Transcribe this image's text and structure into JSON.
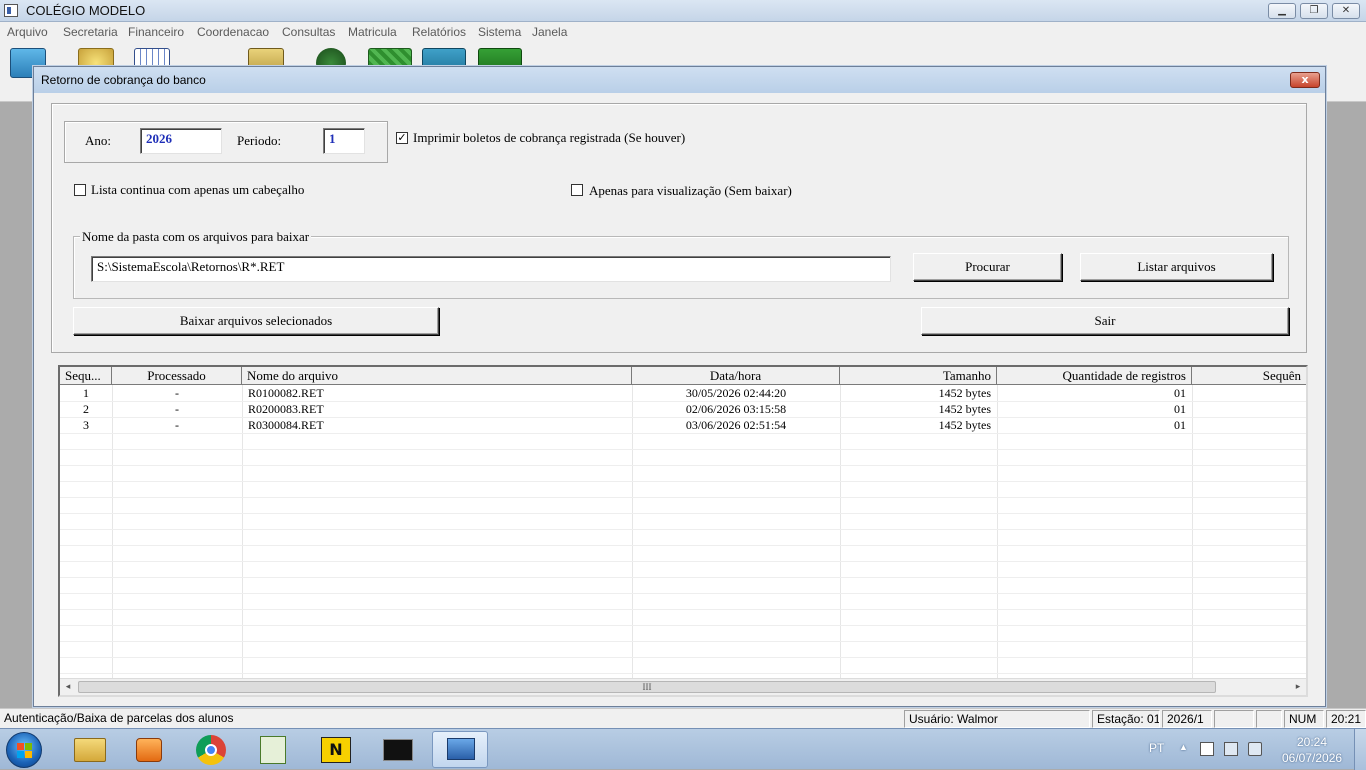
{
  "app": {
    "title": "COLÉGIO MODELO",
    "menu": [
      "Arquivo",
      "Secretaria",
      "Financeiro",
      "Coordenacao",
      "Consultas",
      "Matricula",
      "Relatórios",
      "Sistema",
      "Janela"
    ]
  },
  "dialog": {
    "title": "Retorno de cobrança do banco",
    "close_label": "x",
    "ano_label": "Ano:",
    "ano_value": "2026",
    "periodo_label": "Periodo:",
    "periodo_value": "1",
    "imprimir_label": "Imprimir boletos de cobrança registrada (Se houver)",
    "imprimir_checked": "✓",
    "lista_label": "Lista continua com apenas um cabeçalho",
    "visualizacao_label": "Apenas para visualização (Sem baixar)",
    "pasta_group": "Nome da pasta com os arquivos para baixar",
    "pasta_value": "S:\\SistemaEscola\\Retornos\\R*.RET",
    "procurar_label": "Procurar",
    "listar_label": "Listar arquivos",
    "baixar_label": "Baixar arquivos selecionados",
    "sair_label": "Sair"
  },
  "grid": {
    "columns": [
      "Sequ...",
      "Processado",
      "Nome do arquivo",
      "Data/hora",
      "Tamanho",
      "Quantidade de registros",
      "Sequên"
    ],
    "rows": [
      {
        "seq": "1",
        "proc": "-",
        "nome": "R0100082.RET",
        "data": "30/05/2026 02:44:20",
        "tam": "1452 bytes",
        "qtd": "01"
      },
      {
        "seq": "2",
        "proc": "-",
        "nome": "R0200083.RET",
        "data": "02/06/2026 03:15:58",
        "tam": "1452 bytes",
        "qtd": "01"
      },
      {
        "seq": "3",
        "proc": "-",
        "nome": "R0300084.RET",
        "data": "03/06/2026 02:51:54",
        "tam": "1452 bytes",
        "qtd": "01"
      }
    ],
    "scroll_grip": "III",
    "scroll_left": "◂",
    "scroll_right": "▸"
  },
  "status": {
    "message": "Autenticação/Baixa de parcelas dos alunos",
    "usuario": "Usuário: Walmor",
    "estacao": "Estação: 01",
    "periodo": "2026/1",
    "num": "NUM",
    "hora": "20:21"
  },
  "taskbar": {
    "lang": "PT",
    "tray_arrow": "▲",
    "clock_time": "20:24",
    "clock_date": "06/07/2026"
  },
  "icons": [
    "windows-start-icon",
    "explorer-icon",
    "media-player-icon",
    "chrome-icon",
    "notepad-icon",
    "nero-icon",
    "cmd-icon",
    "network-app-icon",
    "flag-icon",
    "network-tray-icon",
    "volume-icon"
  ]
}
